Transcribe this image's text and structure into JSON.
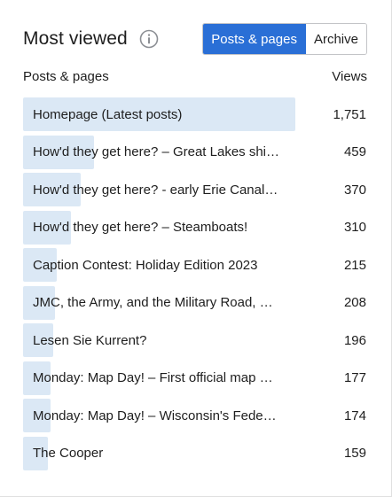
{
  "header": {
    "title": "Most viewed",
    "info_icon": "info-circle-icon",
    "tabs": [
      {
        "label": "Posts & pages",
        "active": true
      },
      {
        "label": "Archive",
        "active": false
      }
    ]
  },
  "columns": {
    "left": "Posts & pages",
    "right": "Views"
  },
  "colors": {
    "accent": "#2a6fd6",
    "bar": "#dbe8f5"
  },
  "rows": [
    {
      "title": "Homepage (Latest posts)",
      "views": "1,751",
      "value": 1751
    },
    {
      "title": "How'd they get here? – Great Lakes shi…",
      "views": "459",
      "value": 459
    },
    {
      "title": "How'd they get here? - early Erie Canal…",
      "views": "370",
      "value": 370
    },
    {
      "title": "How'd they get here? – Steamboats!",
      "views": "310",
      "value": 310
    },
    {
      "title": "Caption Contest: Holiday Edition 2023",
      "views": "215",
      "value": 215
    },
    {
      "title": "JMC, the Army, and the Military Road, …",
      "views": "208",
      "value": 208
    },
    {
      "title": "Lesen Sie Kurrent?",
      "views": "196",
      "value": 196
    },
    {
      "title": "Monday: Map Day! – First official map …",
      "views": "177",
      "value": 177
    },
    {
      "title": "Monday: Map Day! – Wisconsin's Fede…",
      "views": "174",
      "value": 174
    },
    {
      "title": "The Cooper",
      "views": "159",
      "value": 159
    }
  ]
}
